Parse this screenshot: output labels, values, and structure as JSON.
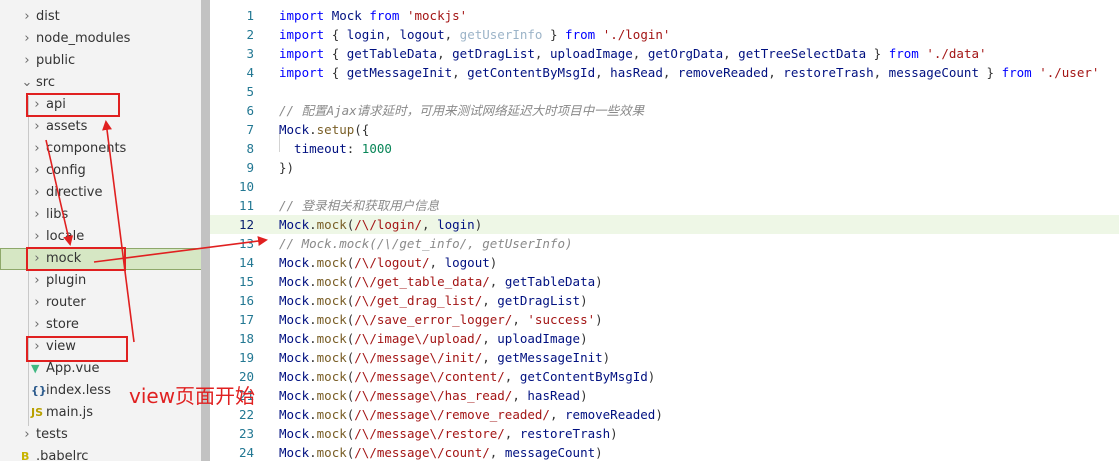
{
  "explorer": {
    "items": [
      {
        "label": "dist",
        "chevron": "›",
        "icon": ""
      },
      {
        "label": "node_modules",
        "chevron": "›",
        "icon": ""
      },
      {
        "label": "public",
        "chevron": "›",
        "icon": ""
      },
      {
        "label": "src",
        "chevron": "⌄",
        "icon": ""
      },
      {
        "label": "api",
        "chevron": "›",
        "icon": ""
      },
      {
        "label": "assets",
        "chevron": "›",
        "icon": ""
      },
      {
        "label": "components",
        "chevron": "›",
        "icon": ""
      },
      {
        "label": "config",
        "chevron": "›",
        "icon": ""
      },
      {
        "label": "directive",
        "chevron": "›",
        "icon": ""
      },
      {
        "label": "libs",
        "chevron": "›",
        "icon": ""
      },
      {
        "label": "locale",
        "chevron": "›",
        "icon": ""
      },
      {
        "label": "mock",
        "chevron": "›",
        "icon": ""
      },
      {
        "label": "plugin",
        "chevron": "›",
        "icon": ""
      },
      {
        "label": "router",
        "chevron": "›",
        "icon": ""
      },
      {
        "label": "store",
        "chevron": "›",
        "icon": ""
      },
      {
        "label": "view",
        "chevron": "›",
        "icon": ""
      },
      {
        "label": "App.vue",
        "chevron": "",
        "icon": "vue-icon"
      },
      {
        "label": "index.less",
        "chevron": "",
        "icon": "less-icon"
      },
      {
        "label": "main.js",
        "chevron": "",
        "icon": "js-icon"
      },
      {
        "label": "tests",
        "chevron": "›",
        "icon": ""
      },
      {
        "label": ".babelrc",
        "chevron": "",
        "icon": "babel-icon"
      }
    ],
    "icon_glyphs": {
      "vue": "▼",
      "less": "{}",
      "js": "JS",
      "babel": "B"
    },
    "selected_item": "mock"
  },
  "editor": {
    "current_line": 12,
    "lines": [
      {
        "n": "1",
        "tokens": [
          {
            "t": "import ",
            "c": "kw"
          },
          {
            "t": "Mock ",
            "c": "ident"
          },
          {
            "t": "from ",
            "c": "kw"
          },
          {
            "t": "'mockjs'",
            "c": "str"
          }
        ]
      },
      {
        "n": "2",
        "tokens": [
          {
            "t": "import ",
            "c": "kw"
          },
          {
            "t": "{ ",
            "c": "punc"
          },
          {
            "t": "login",
            "c": "ident"
          },
          {
            "t": ", ",
            "c": "punc"
          },
          {
            "t": "logout",
            "c": "ident"
          },
          {
            "t": ", ",
            "c": "punc"
          },
          {
            "t": "getUserInfo",
            "c": "dim"
          },
          {
            "t": " } ",
            "c": "punc"
          },
          {
            "t": "from ",
            "c": "kw"
          },
          {
            "t": "'./login'",
            "c": "str"
          }
        ]
      },
      {
        "n": "3",
        "tokens": [
          {
            "t": "import ",
            "c": "kw"
          },
          {
            "t": "{ ",
            "c": "punc"
          },
          {
            "t": "getTableData",
            "c": "ident"
          },
          {
            "t": ", ",
            "c": "punc"
          },
          {
            "t": "getDragList",
            "c": "ident"
          },
          {
            "t": ", ",
            "c": "punc"
          },
          {
            "t": "uploadImage",
            "c": "ident"
          },
          {
            "t": ", ",
            "c": "punc"
          },
          {
            "t": "getOrgData",
            "c": "ident"
          },
          {
            "t": ", ",
            "c": "punc"
          },
          {
            "t": "getTreeSelectData",
            "c": "ident"
          },
          {
            "t": " } ",
            "c": "punc"
          },
          {
            "t": "from ",
            "c": "kw"
          },
          {
            "t": "'./data'",
            "c": "str"
          }
        ]
      },
      {
        "n": "4",
        "tokens": [
          {
            "t": "import ",
            "c": "kw"
          },
          {
            "t": "{ ",
            "c": "punc"
          },
          {
            "t": "getMessageInit",
            "c": "ident"
          },
          {
            "t": ", ",
            "c": "punc"
          },
          {
            "t": "getContentByMsgId",
            "c": "ident"
          },
          {
            "t": ", ",
            "c": "punc"
          },
          {
            "t": "hasRead",
            "c": "ident"
          },
          {
            "t": ", ",
            "c": "punc"
          },
          {
            "t": "removeReaded",
            "c": "ident"
          },
          {
            "t": ", ",
            "c": "punc"
          },
          {
            "t": "restoreTrash",
            "c": "ident"
          },
          {
            "t": ", ",
            "c": "punc"
          },
          {
            "t": "messageCount",
            "c": "ident"
          },
          {
            "t": " } ",
            "c": "punc"
          },
          {
            "t": "from ",
            "c": "kw"
          },
          {
            "t": "'./user'",
            "c": "str"
          }
        ]
      },
      {
        "n": "5",
        "tokens": []
      },
      {
        "n": "6",
        "tokens": [
          {
            "t": "// 配置Ajax请求延时，可用来测试网络延迟大时项目中一些效果",
            "c": "cmt"
          }
        ]
      },
      {
        "n": "7",
        "tokens": [
          {
            "t": "Mock",
            "c": "ident"
          },
          {
            "t": ".",
            "c": "punc"
          },
          {
            "t": "setup",
            "c": "fn"
          },
          {
            "t": "({",
            "c": "punc"
          }
        ]
      },
      {
        "n": "8",
        "tokens": [
          {
            "t": "  timeout",
            "c": "ident"
          },
          {
            "t": ": ",
            "c": "punc"
          },
          {
            "t": "1000",
            "c": "num"
          }
        ]
      },
      {
        "n": "9",
        "tokens": [
          {
            "t": "})",
            "c": "punc"
          }
        ]
      },
      {
        "n": "10",
        "tokens": []
      },
      {
        "n": "11",
        "tokens": [
          {
            "t": "// 登录相关和获取用户信息",
            "c": "cmt"
          }
        ]
      },
      {
        "n": "12",
        "tokens": [
          {
            "t": "Mock",
            "c": "ident"
          },
          {
            "t": ".",
            "c": "punc"
          },
          {
            "t": "mock",
            "c": "fn"
          },
          {
            "t": "(",
            "c": "punc"
          },
          {
            "t": "/\\/login/",
            "c": "str"
          },
          {
            "t": ", ",
            "c": "punc"
          },
          {
            "t": "login",
            "c": "ident"
          },
          {
            "t": ")",
            "c": "punc"
          }
        ]
      },
      {
        "n": "13",
        "tokens": [
          {
            "t": "// Mock.mock(/\\/get_info/, getUserInfo)",
            "c": "cmt"
          }
        ]
      },
      {
        "n": "14",
        "tokens": [
          {
            "t": "Mock",
            "c": "ident"
          },
          {
            "t": ".",
            "c": "punc"
          },
          {
            "t": "mock",
            "c": "fn"
          },
          {
            "t": "(",
            "c": "punc"
          },
          {
            "t": "/\\/logout/",
            "c": "str"
          },
          {
            "t": ", ",
            "c": "punc"
          },
          {
            "t": "logout",
            "c": "ident"
          },
          {
            "t": ")",
            "c": "punc"
          }
        ]
      },
      {
        "n": "15",
        "tokens": [
          {
            "t": "Mock",
            "c": "ident"
          },
          {
            "t": ".",
            "c": "punc"
          },
          {
            "t": "mock",
            "c": "fn"
          },
          {
            "t": "(",
            "c": "punc"
          },
          {
            "t": "/\\/get_table_data/",
            "c": "str"
          },
          {
            "t": ", ",
            "c": "punc"
          },
          {
            "t": "getTableData",
            "c": "ident"
          },
          {
            "t": ")",
            "c": "punc"
          }
        ]
      },
      {
        "n": "16",
        "tokens": [
          {
            "t": "Mock",
            "c": "ident"
          },
          {
            "t": ".",
            "c": "punc"
          },
          {
            "t": "mock",
            "c": "fn"
          },
          {
            "t": "(",
            "c": "punc"
          },
          {
            "t": "/\\/get_drag_list/",
            "c": "str"
          },
          {
            "t": ", ",
            "c": "punc"
          },
          {
            "t": "getDragList",
            "c": "ident"
          },
          {
            "t": ")",
            "c": "punc"
          }
        ]
      },
      {
        "n": "17",
        "tokens": [
          {
            "t": "Mock",
            "c": "ident"
          },
          {
            "t": ".",
            "c": "punc"
          },
          {
            "t": "mock",
            "c": "fn"
          },
          {
            "t": "(",
            "c": "punc"
          },
          {
            "t": "/\\/save_error_logger/",
            "c": "str"
          },
          {
            "t": ", ",
            "c": "punc"
          },
          {
            "t": "'success'",
            "c": "str"
          },
          {
            "t": ")",
            "c": "punc"
          }
        ]
      },
      {
        "n": "18",
        "tokens": [
          {
            "t": "Mock",
            "c": "ident"
          },
          {
            "t": ".",
            "c": "punc"
          },
          {
            "t": "mock",
            "c": "fn"
          },
          {
            "t": "(",
            "c": "punc"
          },
          {
            "t": "/\\/image\\/upload/",
            "c": "str"
          },
          {
            "t": ", ",
            "c": "punc"
          },
          {
            "t": "uploadImage",
            "c": "ident"
          },
          {
            "t": ")",
            "c": "punc"
          }
        ]
      },
      {
        "n": "19",
        "tokens": [
          {
            "t": "Mock",
            "c": "ident"
          },
          {
            "t": ".",
            "c": "punc"
          },
          {
            "t": "mock",
            "c": "fn"
          },
          {
            "t": "(",
            "c": "punc"
          },
          {
            "t": "/\\/message\\/init/",
            "c": "str"
          },
          {
            "t": ", ",
            "c": "punc"
          },
          {
            "t": "getMessageInit",
            "c": "ident"
          },
          {
            "t": ")",
            "c": "punc"
          }
        ]
      },
      {
        "n": "20",
        "tokens": [
          {
            "t": "Mock",
            "c": "ident"
          },
          {
            "t": ".",
            "c": "punc"
          },
          {
            "t": "mock",
            "c": "fn"
          },
          {
            "t": "(",
            "c": "punc"
          },
          {
            "t": "/\\/message\\/content/",
            "c": "str"
          },
          {
            "t": ", ",
            "c": "punc"
          },
          {
            "t": "getContentByMsgId",
            "c": "ident"
          },
          {
            "t": ")",
            "c": "punc"
          }
        ]
      },
      {
        "n": "21",
        "tokens": [
          {
            "t": "Mock",
            "c": "ident"
          },
          {
            "t": ".",
            "c": "punc"
          },
          {
            "t": "mock",
            "c": "fn"
          },
          {
            "t": "(",
            "c": "punc"
          },
          {
            "t": "/\\/message\\/has_read/",
            "c": "str"
          },
          {
            "t": ", ",
            "c": "punc"
          },
          {
            "t": "hasRead",
            "c": "ident"
          },
          {
            "t": ")",
            "c": "punc"
          }
        ]
      },
      {
        "n": "22",
        "tokens": [
          {
            "t": "Mock",
            "c": "ident"
          },
          {
            "t": ".",
            "c": "punc"
          },
          {
            "t": "mock",
            "c": "fn"
          },
          {
            "t": "(",
            "c": "punc"
          },
          {
            "t": "/\\/message\\/remove_readed/",
            "c": "str"
          },
          {
            "t": ", ",
            "c": "punc"
          },
          {
            "t": "removeReaded",
            "c": "ident"
          },
          {
            "t": ")",
            "c": "punc"
          }
        ]
      },
      {
        "n": "23",
        "tokens": [
          {
            "t": "Mock",
            "c": "ident"
          },
          {
            "t": ".",
            "c": "punc"
          },
          {
            "t": "mock",
            "c": "fn"
          },
          {
            "t": "(",
            "c": "punc"
          },
          {
            "t": "/\\/message\\/restore/",
            "c": "str"
          },
          {
            "t": ", ",
            "c": "punc"
          },
          {
            "t": "restoreTrash",
            "c": "ident"
          },
          {
            "t": ")",
            "c": "punc"
          }
        ]
      },
      {
        "n": "24",
        "tokens": [
          {
            "t": "Mock",
            "c": "ident"
          },
          {
            "t": ".",
            "c": "punc"
          },
          {
            "t": "mock",
            "c": "fn"
          },
          {
            "t": "(",
            "c": "punc"
          },
          {
            "t": "/\\/message\\/count/",
            "c": "str"
          },
          {
            "t": ", ",
            "c": "punc"
          },
          {
            "t": "messageCount",
            "c": "ident"
          },
          {
            "t": ")",
            "c": "punc"
          }
        ]
      }
    ]
  },
  "annotation": {
    "text": "view页面开始",
    "color": "#e02020"
  }
}
